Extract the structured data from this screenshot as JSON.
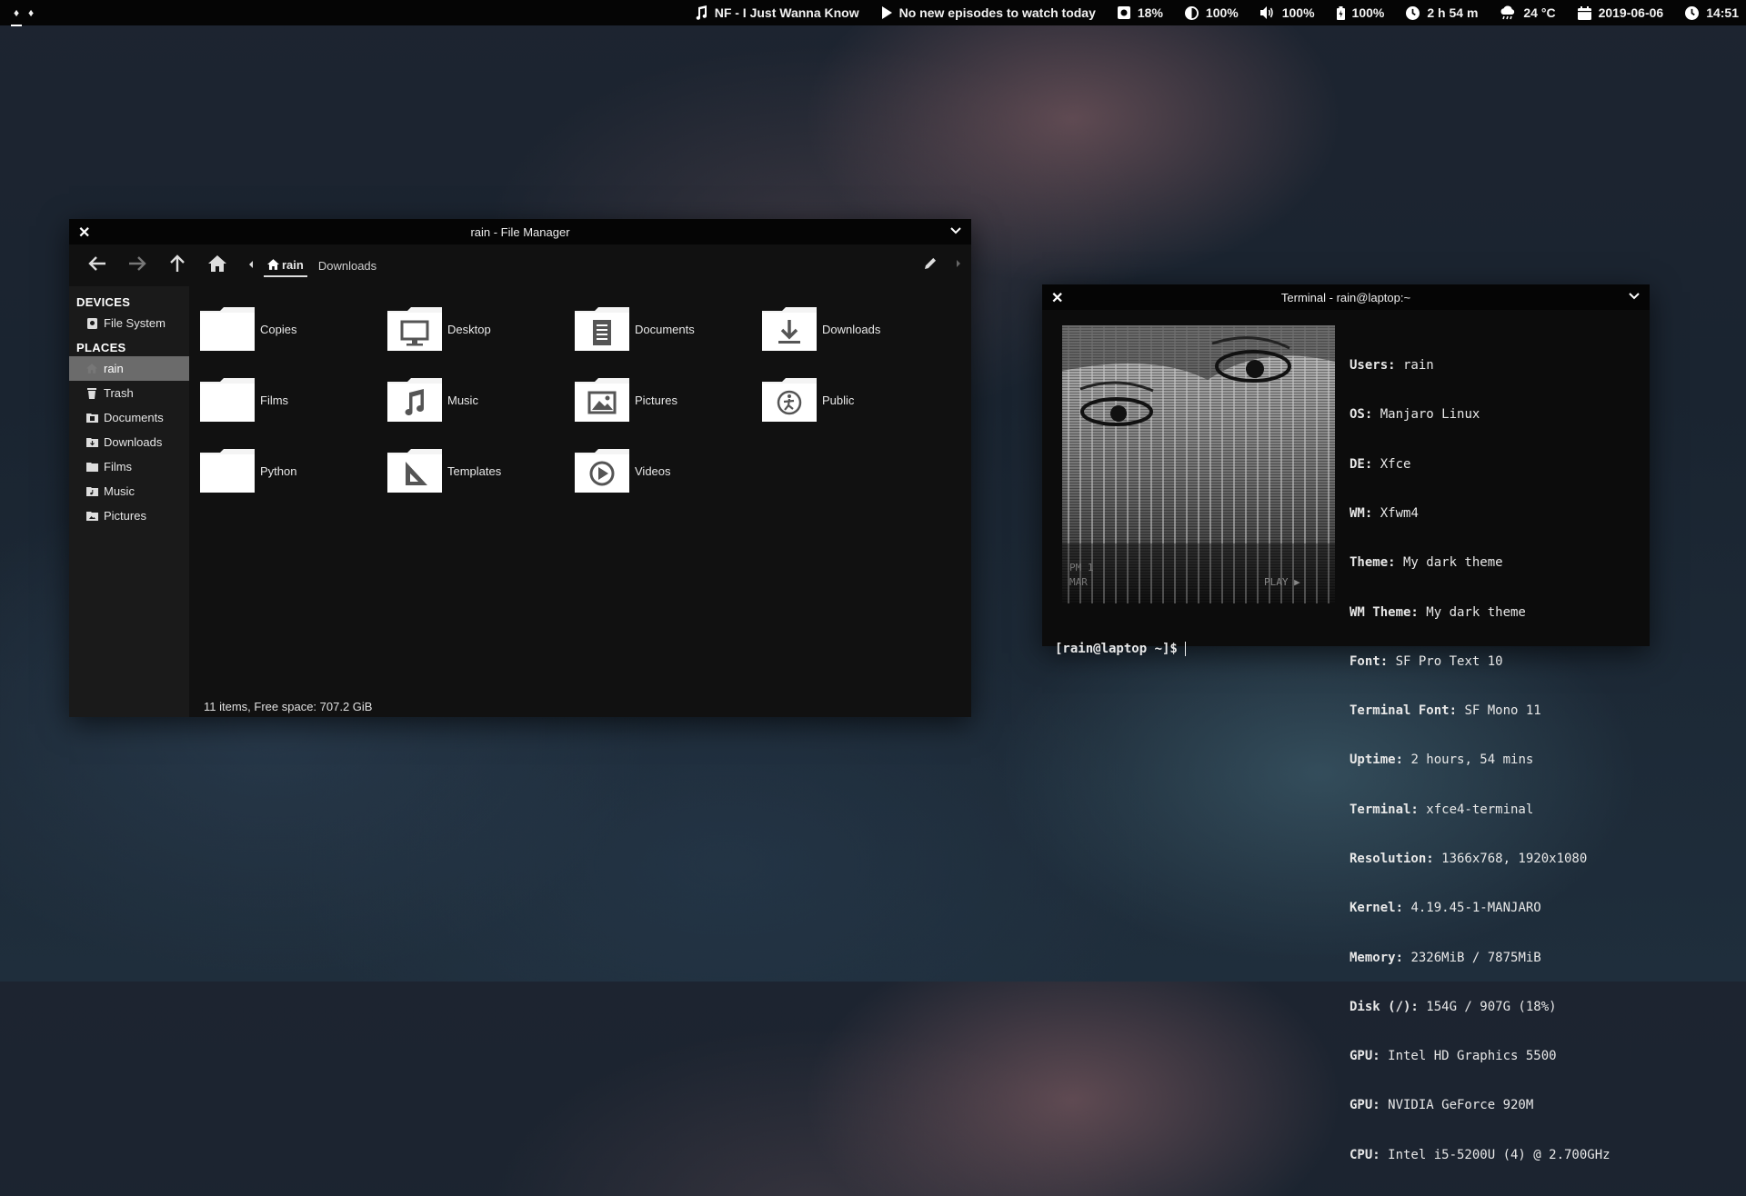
{
  "panel": {
    "workspaces": [
      "♦",
      "♦"
    ],
    "music": "NF - I Just Wanna Know",
    "episodes": "No new episodes to watch today",
    "cpu": "18%",
    "brightness": "100%",
    "volume": "100%",
    "battery": "100%",
    "uptime": "2 h 54 m",
    "weather": "24 °C",
    "date": "2019-06-06",
    "time": "14:51"
  },
  "file_manager": {
    "title": "rain - File Manager",
    "breadcrumb": {
      "home": "rain",
      "next": "Downloads"
    },
    "sidebar": {
      "devices_header": "DEVICES",
      "devices": [
        {
          "label": "File System",
          "icon": "drive-icon"
        }
      ],
      "places_header": "PLACES",
      "places": [
        {
          "label": "rain",
          "icon": "home-icon"
        },
        {
          "label": "Trash",
          "icon": "trash-icon"
        },
        {
          "label": "Documents",
          "icon": "folder-documents-icon"
        },
        {
          "label": "Downloads",
          "icon": "folder-downloads-icon"
        },
        {
          "label": "Films",
          "icon": "folder-icon"
        },
        {
          "label": "Music",
          "icon": "folder-music-icon"
        },
        {
          "label": "Pictures",
          "icon": "folder-pictures-icon"
        }
      ]
    },
    "items": [
      {
        "name": "Copies",
        "icon": "folder-icon"
      },
      {
        "name": "Desktop",
        "icon": "folder-desktop-icon"
      },
      {
        "name": "Documents",
        "icon": "folder-documents-icon"
      },
      {
        "name": "Downloads",
        "icon": "folder-downloads-icon"
      },
      {
        "name": "Films",
        "icon": "folder-icon"
      },
      {
        "name": "Music",
        "icon": "folder-music-icon"
      },
      {
        "name": "Pictures",
        "icon": "folder-pictures-icon"
      },
      {
        "name": "Public",
        "icon": "folder-public-icon"
      },
      {
        "name": "Python",
        "icon": "folder-icon"
      },
      {
        "name": "Templates",
        "icon": "folder-templates-icon"
      },
      {
        "name": "Videos",
        "icon": "folder-videos-icon"
      }
    ],
    "status": "11 items, Free space: 707.2 GiB"
  },
  "terminal": {
    "title": "Terminal - rain@laptop:~",
    "art_overlay": {
      "top": "PM 1",
      "bottom": "MAR",
      "play": "PLAY ▶"
    },
    "info": [
      {
        "key": "Users:",
        "value": " rain"
      },
      {
        "key": "OS:",
        "value": " Manjaro Linux"
      },
      {
        "key": "DE:",
        "value": " Xfce"
      },
      {
        "key": "WM:",
        "value": " Xfwm4"
      },
      {
        "key": "Theme:",
        "value": " My dark theme"
      },
      {
        "key": "WM Theme:",
        "value": " My dark theme"
      },
      {
        "key": "Font:",
        "value": " SF Pro Text 10"
      },
      {
        "key": "Terminal Font:",
        "value": " SF Mono 11"
      },
      {
        "key": "Uptime:",
        "value": " 2 hours, 54 mins"
      },
      {
        "key": "Terminal:",
        "value": " xfce4-terminal"
      },
      {
        "key": "Resolution:",
        "value": " 1366x768, 1920x1080"
      },
      {
        "key": "Kernel:",
        "value": " 4.19.45-1-MANJARO"
      },
      {
        "key": "Memory:",
        "value": " 2326MiB / 7875MiB"
      },
      {
        "key": "Disk (/):",
        "value": " 154G / 907G (18%)"
      },
      {
        "key": "GPU:",
        "value": " Intel HD Graphics 5500"
      },
      {
        "key": "GPU:",
        "value": " NVIDIA GeForce 920M"
      },
      {
        "key": "CPU:",
        "value": " Intel i5-5200U (4) @ 2.700GHz"
      }
    ],
    "prompt": "[rain@laptop ~]$"
  }
}
